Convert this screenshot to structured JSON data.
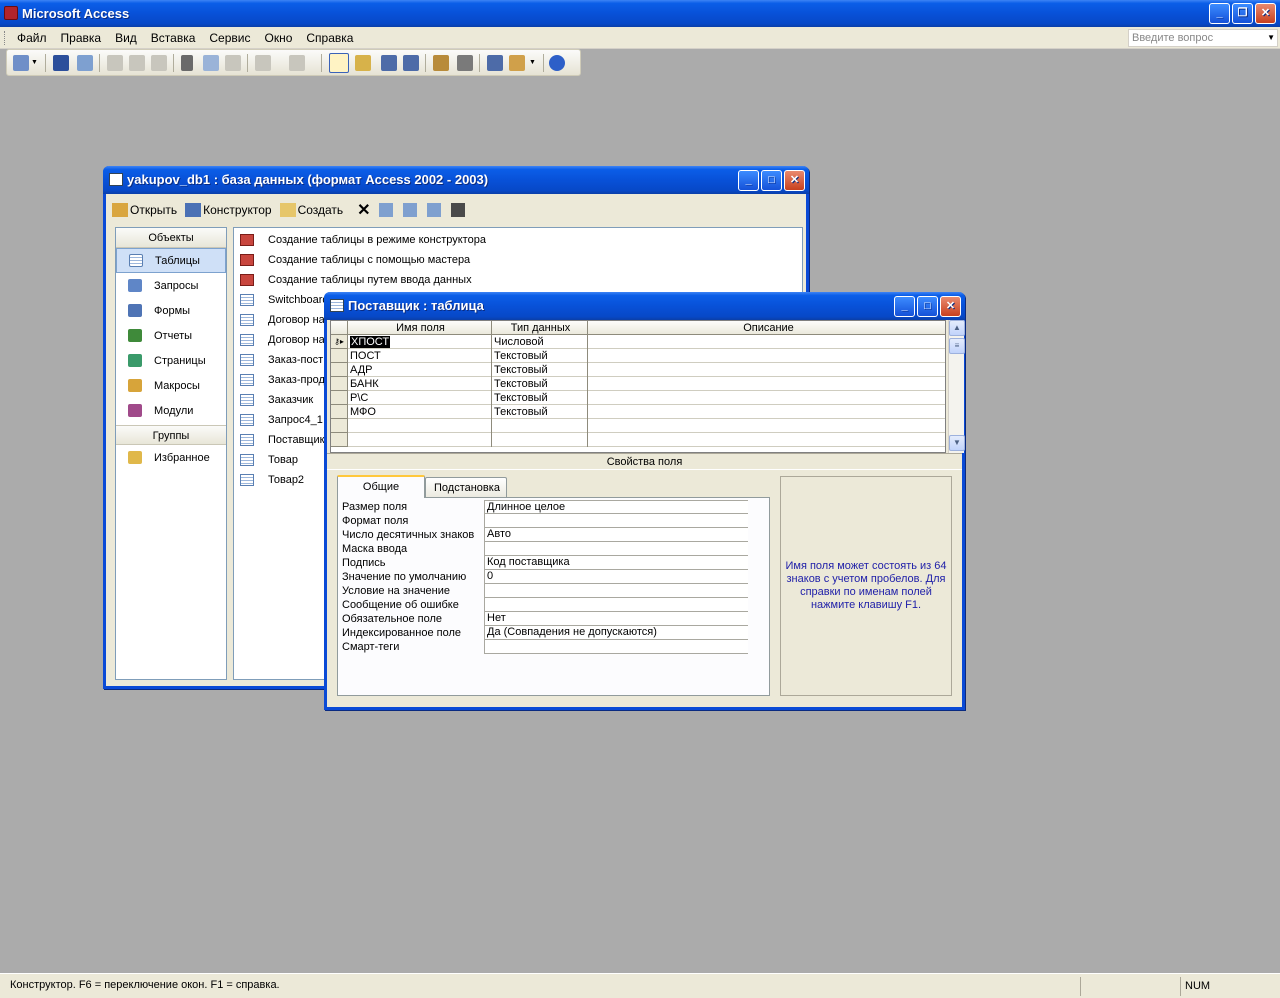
{
  "app": {
    "title": "Microsoft Access"
  },
  "menubar": {
    "items": [
      "Файл",
      "Правка",
      "Вид",
      "Вставка",
      "Сервис",
      "Окно",
      "Справка"
    ],
    "ask_placeholder": "Введите вопрос"
  },
  "db_window": {
    "title": "yakupov_db1 : база данных (формат Access 2002 - 2003)",
    "toolbar": {
      "open": "Открыть",
      "design": "Конструктор",
      "create": "Создать"
    },
    "sidebar": {
      "objects_header": "Объекты",
      "items": [
        "Таблицы",
        "Запросы",
        "Формы",
        "Отчеты",
        "Страницы",
        "Макросы",
        "Модули"
      ],
      "groups_header": "Группы",
      "favorites": "Избранное"
    },
    "list": [
      "Создание таблицы в режиме конструктора",
      "Создание таблицы с помощью мастера",
      "Создание таблицы путем ввода данных",
      "Switchboard",
      "Договор на",
      "Договор на",
      "Заказ-пост",
      "Заказ-прод",
      "Заказчик",
      "Запрос4_1",
      "Поставщик",
      "Товар",
      "Товар2"
    ]
  },
  "table_window": {
    "title": "Поставщик : таблица",
    "columns": [
      "Имя поля",
      "Тип данных",
      "Описание"
    ],
    "rows": [
      {
        "name": "ХПОСТ",
        "type": "Числовой"
      },
      {
        "name": "ПОСТ",
        "type": "Текстовый"
      },
      {
        "name": "АДР",
        "type": "Текстовый"
      },
      {
        "name": "БАНК",
        "type": "Текстовый"
      },
      {
        "name": "Р\\С",
        "type": "Текстовый"
      },
      {
        "name": "МФО",
        "type": "Текстовый"
      }
    ],
    "props_title": "Свойства поля",
    "tabs": [
      "Общие",
      "Подстановка"
    ],
    "props": [
      {
        "label": "Размер поля",
        "value": "Длинное целое"
      },
      {
        "label": "Формат поля",
        "value": ""
      },
      {
        "label": "Число десятичных знаков",
        "value": "Авто"
      },
      {
        "label": "Маска ввода",
        "value": ""
      },
      {
        "label": "Подпись",
        "value": "Код поставщика"
      },
      {
        "label": "Значение по умолчанию",
        "value": "0"
      },
      {
        "label": "Условие на значение",
        "value": ""
      },
      {
        "label": "Сообщение об ошибке",
        "value": ""
      },
      {
        "label": "Обязательное поле",
        "value": "Нет"
      },
      {
        "label": "Индексированное поле",
        "value": "Да (Совпадения не допускаются)"
      },
      {
        "label": "Смарт-теги",
        "value": ""
      }
    ],
    "hint": "Имя поля может состоять из 64 знаков с учетом пробелов. Для справки по именам полей нажмите клавишу F1."
  },
  "statusbar": {
    "text": "Конструктор.  F6 = переключение окон.  F1 = справка.",
    "num": "NUM"
  }
}
